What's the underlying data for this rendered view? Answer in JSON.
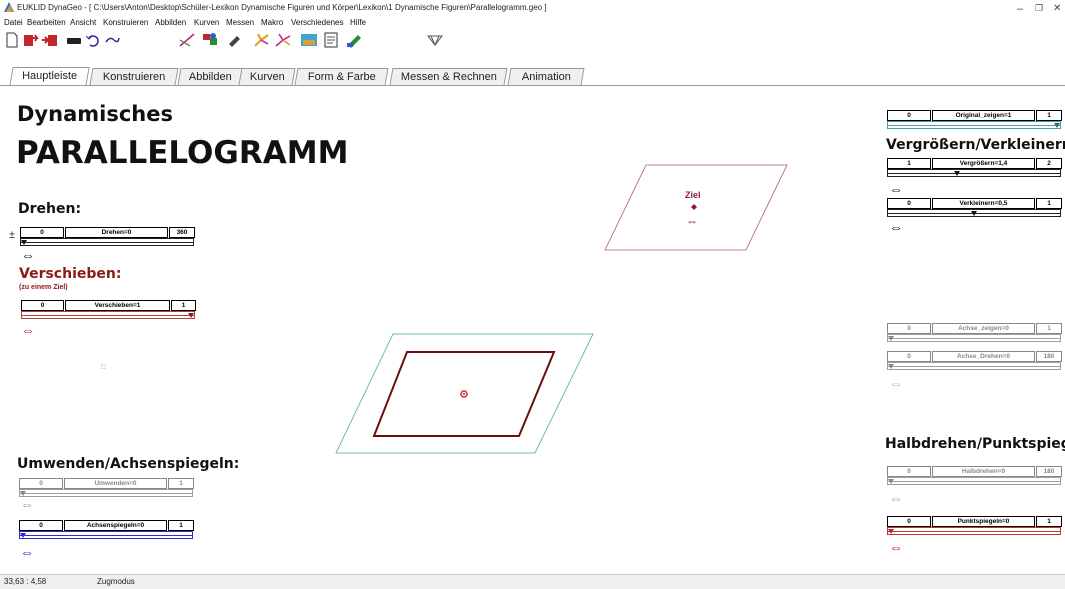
{
  "window": {
    "title": "EUKLID DynaGeo - [ C:\\Users\\Anton\\Desktop\\Schüler-Lexikon Dynamische Figuren und Körper\\Lexikon\\1 Dynamische Figuren\\Parallelogramm.geo ]",
    "controls": {
      "minimize": "–",
      "maximize": "❐",
      "close": "✕"
    }
  },
  "menu": [
    "Datei",
    "Bearbeiten",
    "Ansicht",
    "Konstruieren",
    "Abbilden",
    "Kurven",
    "Messen",
    "Makro",
    "Verschiedenes",
    "Hilfe"
  ],
  "tabs": [
    "Hauptleiste",
    "Konstruieren",
    "Abbilden",
    "Kurven",
    "Form & Farbe",
    "Messen & Rechnen",
    "Animation"
  ],
  "heading": {
    "line1": "Dynamisches",
    "line2": "PARALLELOGRAMM"
  },
  "sections": {
    "drehen": "Drehen:",
    "verschieben": "Verschieben:",
    "verschieben_sub": "(zu einem Ziel)",
    "umwenden": "Umwenden/Achsenspiegeln:",
    "vergroessern": "Vergrößern/Verkleinern:",
    "halbdrehen": "Halbdrehen/Punktspiegeln:"
  },
  "target_label": "Ziel",
  "arrow_glyph": "⇔",
  "plusminus": "±",
  "small_square": "□",
  "sliders": {
    "drehen": {
      "min": "0",
      "label": "Drehen=0",
      "max": "360",
      "fraction": 0.0
    },
    "verschieben": {
      "min": "0",
      "label": "Verschieben=1",
      "max": "1",
      "fraction": 1.0
    },
    "umwenden": {
      "min": "0",
      "label": "Umwenden=0",
      "max": "1",
      "fraction": 0.0
    },
    "achsenspiegeln": {
      "min": "0",
      "label": "Achsenspiegeln=0",
      "max": "1",
      "fraction": 0.0
    },
    "original": {
      "min": "0",
      "label": "Original_zeigen=1",
      "max": "1",
      "fraction": 1.0
    },
    "vergroessern": {
      "min": "1",
      "label": "Vergrößern=1,4",
      "max": "2",
      "fraction": 0.4
    },
    "verkleinern": {
      "min": "0",
      "label": "Verkleinern=0,5",
      "max": "1",
      "fraction": 0.5
    },
    "achse_zeigen": {
      "min": "0",
      "label": "Achse_zeigen=0",
      "max": "1",
      "fraction": 0.0
    },
    "achse_drehen": {
      "min": "0",
      "label": "Achse_Drehen=0",
      "max": "180",
      "fraction": 0.0
    },
    "halbdrehen": {
      "min": "0",
      "label": "Halbdrehen=0",
      "max": "180",
      "fraction": 0.0
    },
    "punktspiegeln": {
      "min": "0",
      "label": "Punktspiegeln=0",
      "max": "1",
      "fraction": 0.0
    }
  },
  "status": {
    "coords": "33,63 : 4,58",
    "mode": "Zugmodus"
  },
  "colors": {
    "dark_red": "#7b1010",
    "teal": "#6fb8b8",
    "pink": "#b25a5a",
    "target": "#8b1a4a",
    "blue": "#2c2ccf"
  }
}
